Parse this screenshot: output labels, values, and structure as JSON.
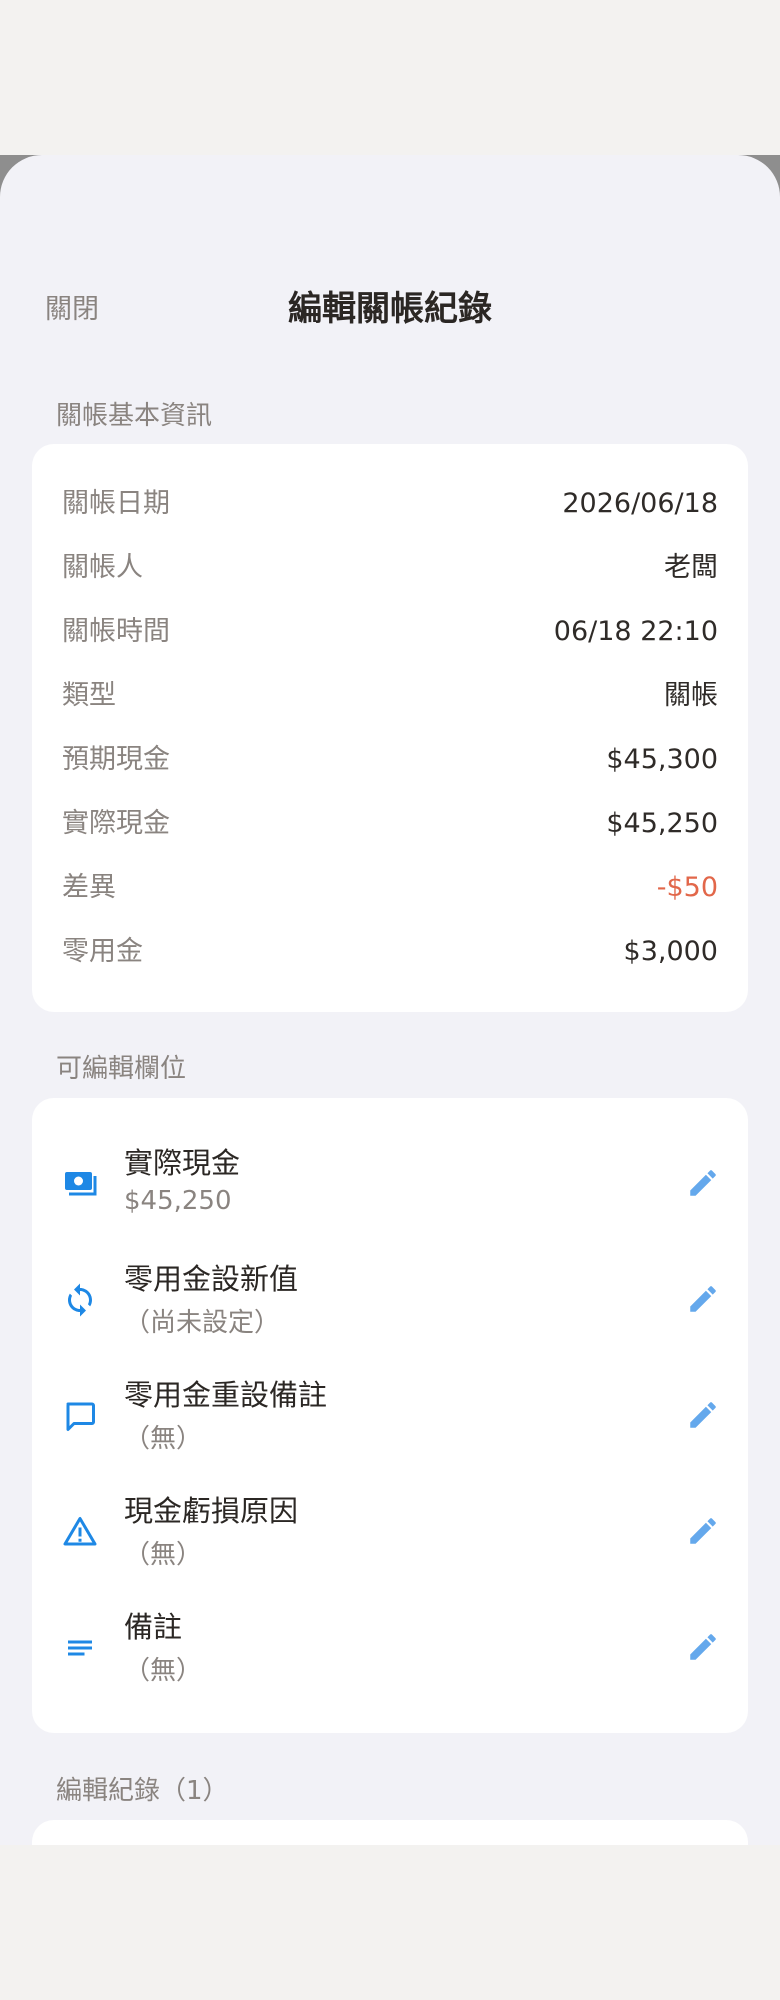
{
  "header": {
    "close_label": "關閉",
    "title": "編輯關帳紀錄"
  },
  "basic_info": {
    "section_label": "關帳基本資訊",
    "rows": [
      {
        "label": "關帳日期",
        "value": "2026/06/18"
      },
      {
        "label": "關帳人",
        "value": "老闆"
      },
      {
        "label": "關帳時間",
        "value": "06/18 22:10"
      },
      {
        "label": "類型",
        "value": "關帳"
      },
      {
        "label": "預期現金",
        "value": "$45,300"
      },
      {
        "label": "實際現金",
        "value": "$45,250"
      },
      {
        "label": "差異",
        "value": "-$50"
      },
      {
        "label": "零用金",
        "value": "$3,000"
      }
    ]
  },
  "editable": {
    "section_label": "可編輯欄位",
    "items": [
      {
        "title": "實際現金",
        "value": "$45,250",
        "icon": "cash-icon"
      },
      {
        "title": "零用金設新值",
        "value": "（尚未設定）",
        "icon": "refresh-icon"
      },
      {
        "title": "零用金重設備註",
        "value": "（無）",
        "icon": "comment-icon"
      },
      {
        "title": "現金虧損原因",
        "value": "（無）",
        "icon": "warning-icon"
      },
      {
        "title": "備註",
        "value": "（無）",
        "icon": "notes-icon"
      }
    ]
  },
  "history": {
    "section_label": "編輯紀錄（1）"
  },
  "colors": {
    "accent": "#1e88e5",
    "accent_light": "#64a8ec",
    "negative": "#e2674a",
    "muted_text": "#8a8480",
    "sheet_bg": "#f2f2f7"
  }
}
